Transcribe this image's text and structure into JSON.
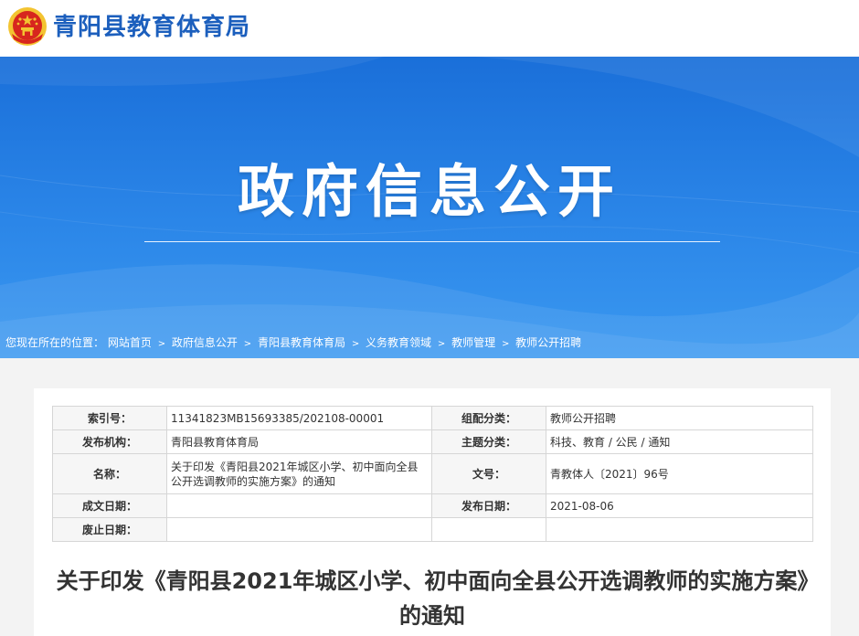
{
  "header": {
    "site_name": "青阳县教育体育局",
    "emblem_icon": "national-emblem-icon"
  },
  "banner": {
    "title": "政府信息公开"
  },
  "breadcrumb": {
    "prefix": "您现在所在的位置：",
    "separator": ">",
    "items": [
      "网站首页",
      "政府信息公开",
      "青阳县教育体育局",
      "义务教育领域",
      "教师管理",
      "教师公开招聘"
    ]
  },
  "meta": {
    "index_label": "索引号：",
    "index_value": "11341823MB15693385/202108-00001",
    "category_label": "组配分类：",
    "category_value": "教师公开招聘",
    "publisher_label": "发布机构：",
    "publisher_value": "青阳县教育体育局",
    "topic_label": "主题分类：",
    "topic_value": "科技、教育 / 公民 / 通知",
    "name_label": "名称：",
    "name_value": "关于印发《青阳县2021年城区小学、初中面向全县公开选调教师的实施方案》的通知",
    "doc_no_label": "文号：",
    "doc_no_value": "青教体人〔2021〕96号",
    "created_label": "成文日期：",
    "created_value": "",
    "published_label": "发布日期：",
    "published_value": "2021-08-06",
    "expired_label": "废止日期：",
    "expired_value": ""
  },
  "article": {
    "title": "关于印发《青阳县2021年城区小学、初中面向全县公开选调教师的实施方案》的通知"
  },
  "colors": {
    "brand_blue": "#1c5fbd",
    "banner_blue": "#2b86e8",
    "emblem_red": "#d7261e",
    "emblem_gold": "#f3c431"
  }
}
